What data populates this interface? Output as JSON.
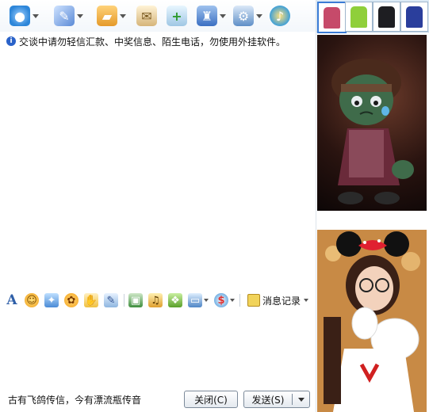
{
  "toolbar": {
    "buttons": [
      {
        "icon": "webcam-icon",
        "color": "#2d86d9",
        "dropdown": true
      },
      {
        "icon": "microphone-icon",
        "color": "#5b8ad6",
        "dropdown": true
      },
      {
        "icon": "folder-transfer-icon",
        "color": "#3a86d6",
        "dropdown": true
      },
      {
        "icon": "mail-icon",
        "color": "#c8a050",
        "dropdown": false
      },
      {
        "icon": "add-app-icon",
        "color": "#4aa04a",
        "dropdown": false
      },
      {
        "icon": "remote-assist-icon",
        "color": "#3b6fc2",
        "dropdown": true
      },
      {
        "icon": "settings-icon",
        "color": "#5f8fc7",
        "dropdown": true
      },
      {
        "icon": "music-icon",
        "color": "#3fa0d8",
        "dropdown": false
      }
    ]
  },
  "notice": {
    "text": "交谈中请勿轻信汇款、中奖信息、陌生电话，勿使用外挂软件。"
  },
  "format_toolbar": {
    "history_label": "消息记录"
  },
  "bottom": {
    "quote": "古有飞鸽传信，今有漂流瓶传音",
    "close_label": "关闭(C)",
    "send_label": "发送(S)"
  },
  "shop": {
    "items": [
      {
        "color": "#c64a6a"
      },
      {
        "color": "#8fcf3a"
      },
      {
        "color": "#1e1e22"
      },
      {
        "color": "#2a3e9c"
      }
    ]
  }
}
